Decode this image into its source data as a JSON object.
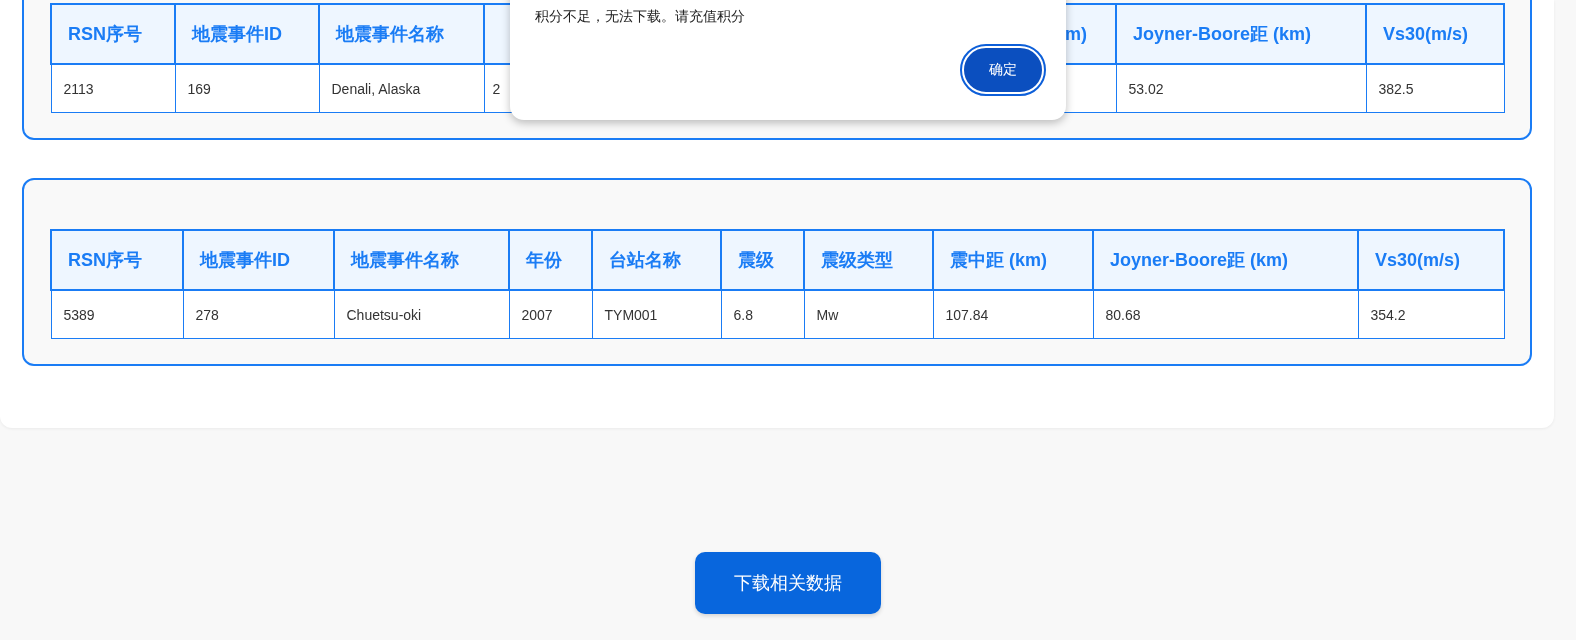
{
  "tables": [
    {
      "columns": [
        "RSN序号",
        "地震事件ID",
        "地震事件名称",
        null,
        "m)",
        "Joyner-Boore距 (km)",
        "Vs30(m/s)"
      ],
      "rows": [
        [
          "2113",
          "169",
          "Denali, Alaska",
          "2",
          null,
          "53.02",
          "382.5"
        ]
      ]
    },
    {
      "columns": [
        "RSN序号",
        "地震事件ID",
        "地震事件名称",
        "年份",
        "台站名称",
        "震级",
        "震级类型",
        "震中距 (km)",
        "Joyner-Boore距 (km)",
        "Vs30(m/s)"
      ],
      "rows": [
        [
          "5389",
          "278",
          "Chuetsu-oki",
          "2007",
          "TYM001",
          "6.8",
          "Mw",
          "107.84",
          "80.68",
          "354.2"
        ]
      ]
    }
  ],
  "dialog": {
    "message": "积分不足，无法下载。请充值积分",
    "button": "确定"
  },
  "download_button": "下载相关数据"
}
